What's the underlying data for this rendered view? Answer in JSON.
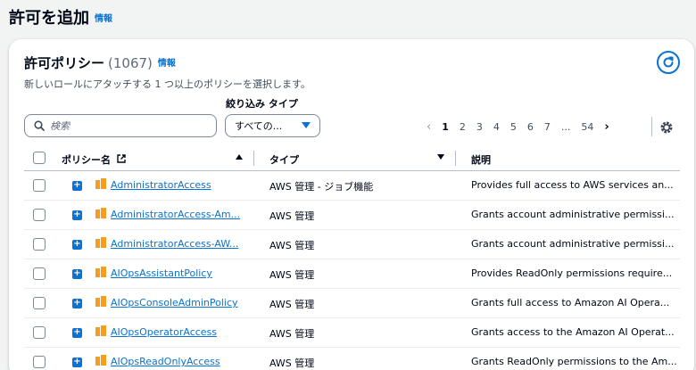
{
  "page": {
    "title": "許可を追加",
    "info": "情報"
  },
  "panel": {
    "title": "許可ポリシー",
    "count": "(1067)",
    "info": "情報",
    "description": "新しいロールにアタッチする 1 つ以上のポリシーを選択します。"
  },
  "filter": {
    "label": "絞り込み タイプ",
    "search_placeholder": "検索",
    "type_value": "すべての..."
  },
  "pagination": {
    "pages": [
      "1",
      "2",
      "3",
      "4",
      "5",
      "6",
      "7",
      "...",
      "54"
    ],
    "current": "1"
  },
  "table": {
    "headers": {
      "name": "ポリシー名",
      "type": "タイプ",
      "description": "説明"
    },
    "rows": [
      {
        "name": "AdministratorAccess",
        "type": "AWS 管理 - ジョブ機能",
        "description": "Provides full access to AWS services an..."
      },
      {
        "name": "AdministratorAccess-Am...",
        "type": "AWS 管理",
        "description": "Grants account administrative permissi..."
      },
      {
        "name": "AdministratorAccess-AW...",
        "type": "AWS 管理",
        "description": "Grants account administrative permissi..."
      },
      {
        "name": "AIOpsAssistantPolicy",
        "type": "AWS 管理",
        "description": "Provides ReadOnly permissions require..."
      },
      {
        "name": "AIOpsConsoleAdminPolicy",
        "type": "AWS 管理",
        "description": "Grants full access to Amazon AI Opera..."
      },
      {
        "name": "AIOpsOperatorAccess",
        "type": "AWS 管理",
        "description": "Grants access to the Amazon AI Operat..."
      },
      {
        "name": "AIOpsReadOnlyAccess",
        "type": "AWS 管理",
        "description": "Grants ReadOnly permissions to the Am..."
      }
    ]
  },
  "colors": {
    "link": "#0972d3",
    "policy_icon": "#f89c1c",
    "text": "#000716"
  }
}
